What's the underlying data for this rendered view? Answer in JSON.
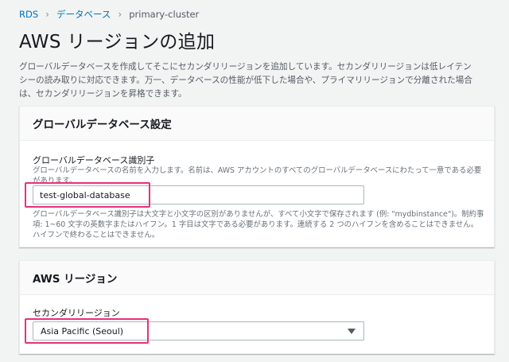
{
  "breadcrumb": {
    "items": [
      "RDS",
      "データベース",
      "primary-cluster"
    ]
  },
  "page": {
    "title": "AWS リージョンの追加",
    "intro_line1": "グローバルデータベースを作成してそこにセカンダリリージョンを追加しています。セカンダリリージョンは低レイテン",
    "intro_line2": "シーの読み取りに対応できます。万一、データベースの性能が低下した場合や、プライマリリージョンで分離された場合",
    "intro_line3": "は、セカンダリリージョンを昇格できます。"
  },
  "global_db_panel": {
    "header": "グローバルデータベース設定",
    "identifier_label": "グローバルデータベース識別子",
    "identifier_desc_line1": "グローバルデータベースの名前を入力します。名前は、AWS アカウントのすべてのグローバルデータベースにわたって一意である必要",
    "identifier_desc_line2": "があります。",
    "identifier_value": "test-global-database",
    "help_line1": "グローバルデータベース識別子は大文字と小文字の区別がありませんが、すべて小文字で保存されます (例: \"mydbinstance\")。制約事",
    "help_line2": "項: 1~60 文字の英数字またはハイフン。1 字目は文字である必要があります。連続する 2 つのハイフンを含めることはできません。",
    "help_line3": "ハイフンで終わることはできません。"
  },
  "region_panel": {
    "header": "AWS リージョン",
    "secondary_label": "セカンダリリージョン",
    "secondary_value": "Asia Pacific (Seoul)"
  },
  "colors": {
    "link": "#0073bb",
    "highlight": "#e8307d",
    "background": "#f2f3f3"
  }
}
